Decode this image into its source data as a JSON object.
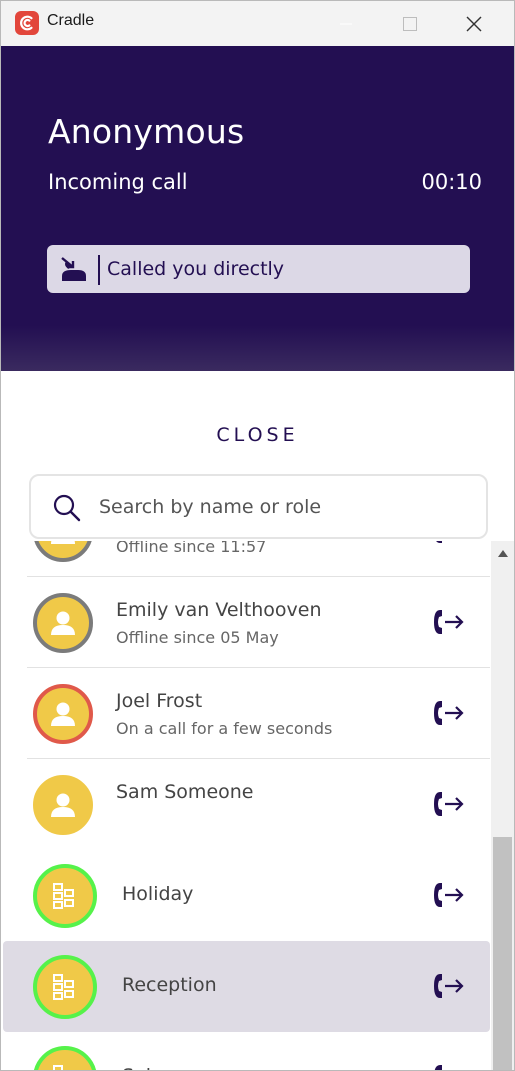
{
  "window": {
    "title": "Cradle"
  },
  "call": {
    "caller_name": "Anonymous",
    "status": "Incoming call",
    "timer": "00:10",
    "info": "Called you directly"
  },
  "close_label": "CLOSE",
  "search": {
    "placeholder": "Search by name or role",
    "value": ""
  },
  "contacts": [
    {
      "name": "",
      "status": "Offline since 11:57",
      "avatar_type": "person",
      "ring": "gray"
    },
    {
      "name": "Emily van Velthooven",
      "status": "Offline since 05 May",
      "avatar_type": "person",
      "ring": "gray"
    },
    {
      "name": "Joel Frost",
      "status": "On a call for a few seconds",
      "avatar_type": "person",
      "ring": "red"
    },
    {
      "name": "Sam Someone",
      "status": "",
      "avatar_type": "person",
      "ring": "none"
    },
    {
      "name": "Holiday",
      "status": "",
      "avatar_type": "group",
      "ring": "green"
    },
    {
      "name": "Reception",
      "status": "",
      "avatar_type": "group",
      "ring": "green",
      "selected": true
    },
    {
      "name": "Sales",
      "status": "",
      "avatar_type": "group",
      "ring": "green"
    }
  ],
  "colors": {
    "header_bg": "#230f52",
    "avatar_fill": "#f0c948",
    "ring_gray": "#7b7b7b",
    "ring_red": "#e0594a",
    "ring_green": "#56f24a",
    "selected_row": "#dedbe4",
    "accent": "#230f52"
  },
  "icons": {
    "app": "cradle-logo-icon",
    "search": "search-icon",
    "transfer": "phone-transfer-icon",
    "direct_call": "direct-call-icon"
  }
}
